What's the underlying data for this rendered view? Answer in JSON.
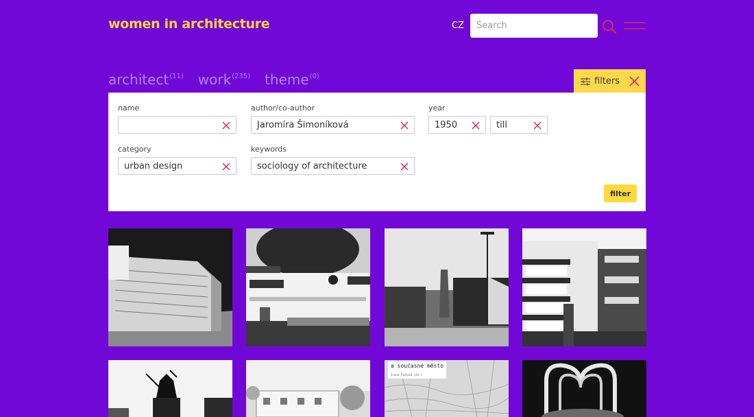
{
  "header": {
    "logo": "women in architecture",
    "lang": "CZ",
    "search_placeholder": "Search"
  },
  "tabs": [
    {
      "label": "architect",
      "count": "(11)"
    },
    {
      "label": "work",
      "count": "(235)"
    },
    {
      "label": "theme",
      "count": "(0)"
    }
  ],
  "filters_toggle": {
    "label": "filters"
  },
  "filters": {
    "name": {
      "label": "name",
      "value": ""
    },
    "author": {
      "label": "author/co-author",
      "value": "Jaromíra Šimoníková"
    },
    "year": {
      "label": "year",
      "from": "1950",
      "till": "till"
    },
    "category": {
      "label": "category",
      "value": "urban design"
    },
    "keywords": {
      "label": "keywords",
      "value": "sociology of architecture"
    },
    "submit_label": "filter"
  },
  "colors": {
    "background": "#7108d8",
    "accent": "#ffd23f",
    "clear_icon": "#e0245e"
  },
  "grid_texts": {
    "book_title": "a současné město",
    "book_author": "Irena Fialová (ed.)"
  }
}
